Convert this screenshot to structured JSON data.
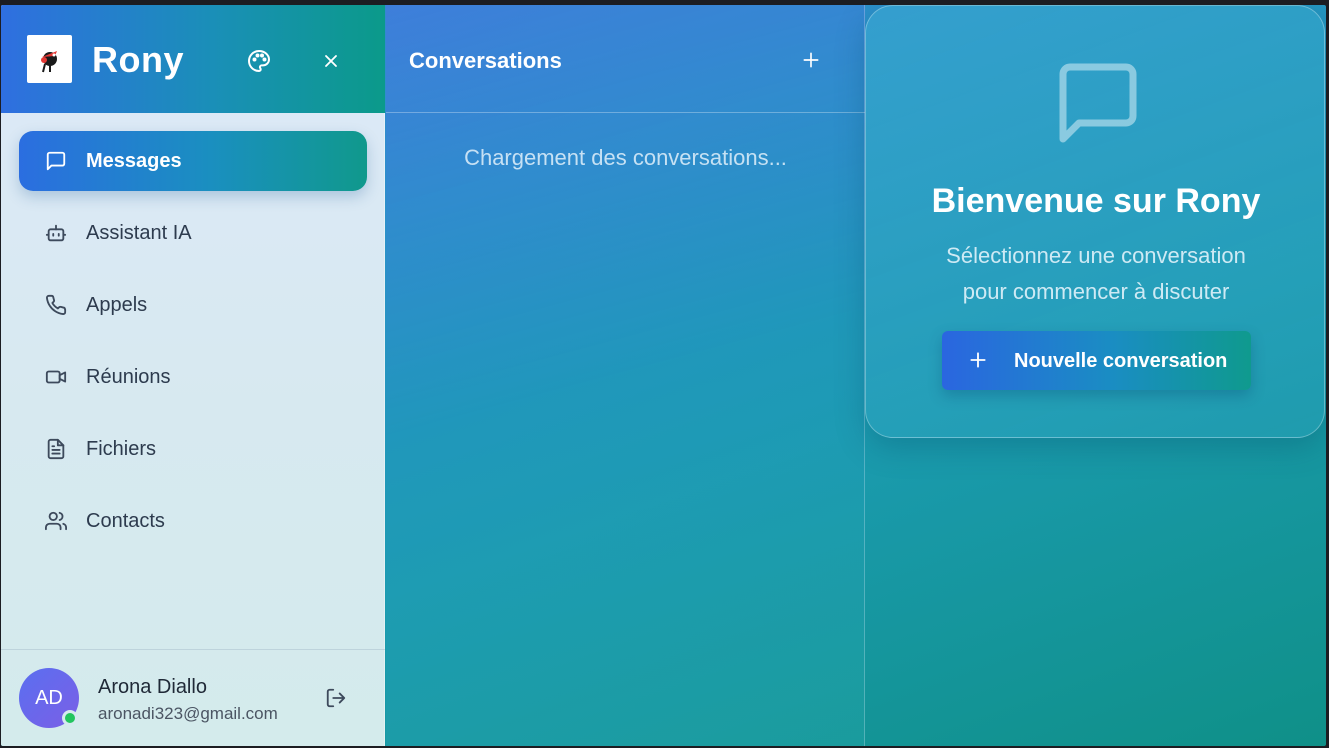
{
  "app": {
    "brand": "Rony"
  },
  "sidebar": {
    "items": [
      {
        "label": "Messages",
        "icon": "message-square-icon",
        "active": true
      },
      {
        "label": "Assistant IA",
        "icon": "bot-icon",
        "active": false
      },
      {
        "label": "Appels",
        "icon": "phone-icon",
        "active": false
      },
      {
        "label": "Réunions",
        "icon": "video-icon",
        "active": false
      },
      {
        "label": "Fichiers",
        "icon": "file-text-icon",
        "active": false
      },
      {
        "label": "Contacts",
        "icon": "users-icon",
        "active": false
      }
    ],
    "user": {
      "initials": "AD",
      "name": "Arona Diallo",
      "email": "aronadi323@gmail.com",
      "status": "online"
    }
  },
  "conversations": {
    "title": "Conversations",
    "loading_text": "Chargement des conversations..."
  },
  "welcome": {
    "title": "Bienvenue sur Rony",
    "subtitle_line1": "Sélectionnez une conversation",
    "subtitle_line2": "pour commencer à discuter",
    "button_label": "Nouvelle conversation"
  },
  "colors": {
    "accent_start": "#2b6ee0",
    "accent_end": "#10998c",
    "online": "#22c55e",
    "avatar": "#6366f1"
  }
}
